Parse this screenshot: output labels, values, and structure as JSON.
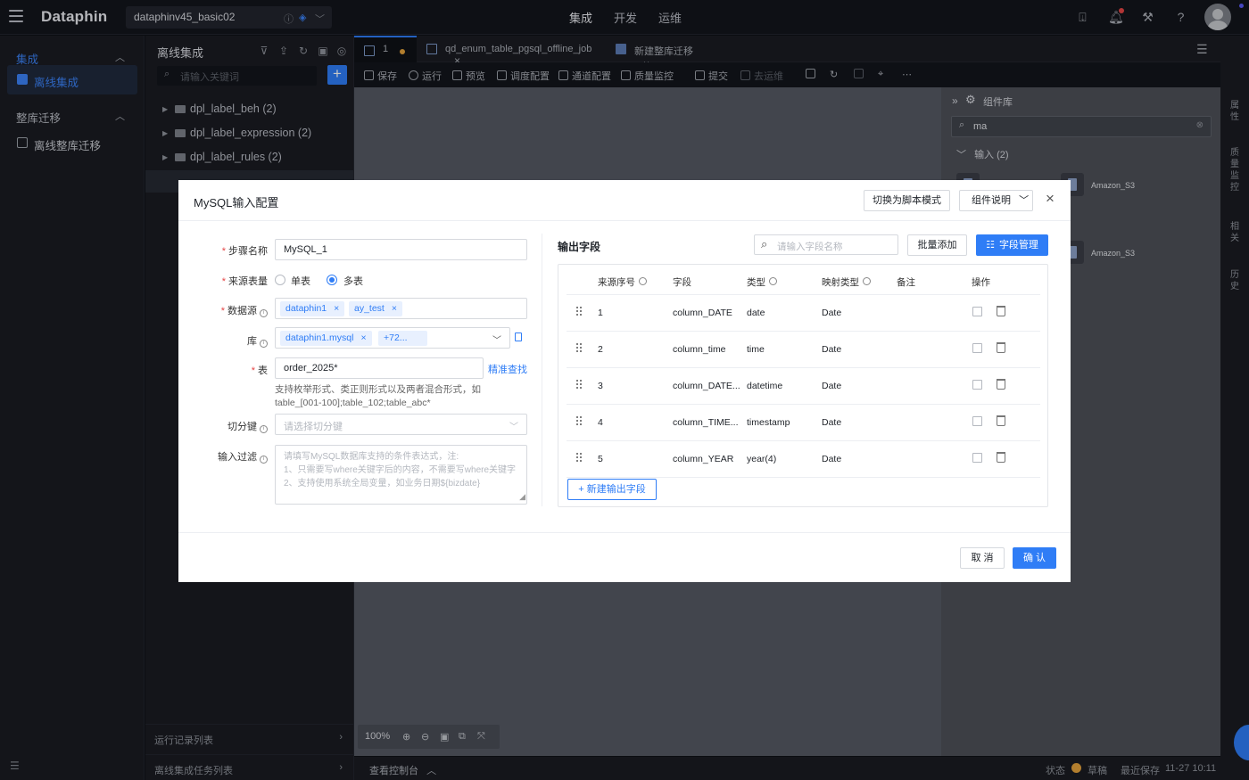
{
  "app": {
    "logo": "Dataphin",
    "project": "dataphinv45_basic02",
    "nav": [
      "集成",
      "开发",
      "运维"
    ]
  },
  "sidebar": {
    "group1": "集成",
    "item1": "离线集成",
    "group2": "整库迁移",
    "item2": "离线整库迁移"
  },
  "tree": {
    "title": "离线集成",
    "search_placeholder": "请输入关键词",
    "nodes": [
      "dpl_label_beh (2)",
      "dpl_label_expression (2)",
      "dpl_label_rules (2)"
    ],
    "bottom1": "运行记录列表",
    "bottom2": "离线集成任务列表"
  },
  "tabs": [
    {
      "label": "1"
    },
    {
      "label": "qd_enum_table_pgsql_offline_job"
    },
    {
      "label": "新建整库迁移"
    }
  ],
  "toolbar": [
    "保存",
    "运行",
    "预览",
    "调度配置",
    "通道配置",
    "质量监控",
    "提交",
    "去运维"
  ],
  "canvas": {
    "zoom": "100%",
    "console": "查看控制台"
  },
  "component_panel": {
    "title": "组件库",
    "search_value": "ma",
    "group": "输入 (2)",
    "items": [
      "Amazon_S3",
      "Amazon_S3"
    ]
  },
  "rightbar": [
    "属性",
    "质量监控",
    "相关",
    "历史"
  ],
  "status": {
    "label": "状态",
    "value": "草稿",
    "saved_label": "最近保存",
    "saved_time": "11-27 10:11"
  },
  "modal": {
    "title": "MySQL输入配置",
    "switch_script": "切换为脚本模式",
    "component_help": "组件说明",
    "form": {
      "step_name_label": "步骤名称",
      "step_name_value": "MySQL_1",
      "source_label": "来源表量",
      "radio_single": "单表",
      "radio_multi": "多表",
      "datasource_label": "数据源",
      "datasource_tags": [
        "dataphin1",
        "ay_test"
      ],
      "db_label": "库",
      "db_tags": [
        "dataphin1.mysql",
        "+72..."
      ],
      "table_label": "表",
      "table_value": "order_2025*",
      "table_link": "精准查找",
      "table_hint": "支持枚举形式、类正则形式以及两者混合形式，如 table_[001-100];table_102;table_abc*",
      "split_label": "切分键",
      "split_placeholder": "请选择切分键",
      "filter_label": "输入过滤",
      "filter_placeholder_1": "请填写MySQL数据库支持的条件表达式，注:",
      "filter_placeholder_2": "1、只需要写where关键字后的内容，不需要写where关键字",
      "filter_placeholder_3": "2、支持使用系统全局变量，如业务日期${bizdate}"
    },
    "output": {
      "title": "输出字段",
      "search_placeholder": "请输入字段名称",
      "batch_add": "批量添加",
      "field_manage": "字段管理",
      "columns": [
        "来源序号",
        "字段",
        "类型",
        "映射类型",
        "备注",
        "操作"
      ],
      "rows": [
        {
          "seq": "1",
          "field": "column_DATE",
          "type": "date",
          "map": "Date"
        },
        {
          "seq": "2",
          "field": "column_time",
          "type": "time",
          "map": "Date"
        },
        {
          "seq": "3",
          "field": "column_DATE...",
          "type": "datetime",
          "map": "Date"
        },
        {
          "seq": "4",
          "field": "column_TIME...",
          "type": "timestamp",
          "map": "Date"
        },
        {
          "seq": "5",
          "field": "column_YEAR",
          "type": "year(4)",
          "map": "Date"
        }
      ],
      "add_field": "新建输出字段"
    },
    "cancel": "取 消",
    "confirm": "确 认"
  },
  "colors": {
    "accent": "#2f7df6",
    "required": "#e54545",
    "bg_dark": "#13151b"
  }
}
